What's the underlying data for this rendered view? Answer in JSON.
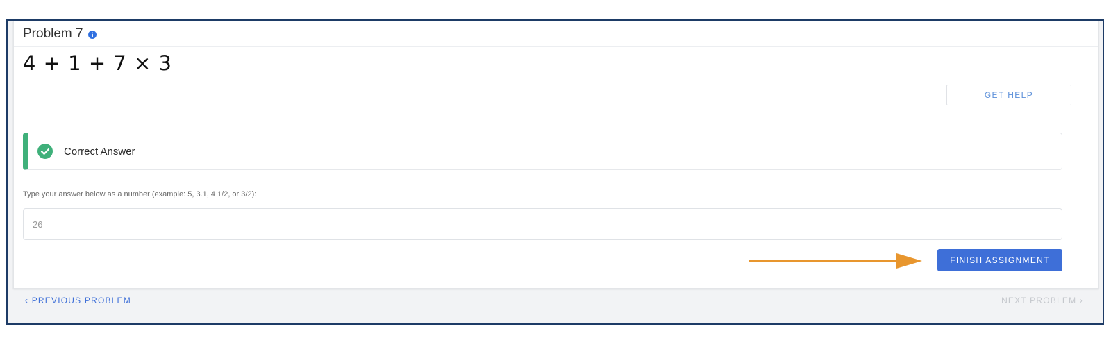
{
  "problem": {
    "title": "Problem 7",
    "info_icon": "info-icon",
    "expression": "4 + 1 + 7 × 3"
  },
  "help": {
    "label": "GET HELP"
  },
  "feedback": {
    "icon": "check-circle-icon",
    "text": "Correct Answer",
    "accent_color": "#3fb07a"
  },
  "answer": {
    "instruction": "Type your answer below as a number (example: 5, 3.1, 4 1/2, or 3/2):",
    "value": "26"
  },
  "finish": {
    "label": "FINISH ASSIGNMENT",
    "color": "#3e6fd8"
  },
  "annotation": {
    "arrow_color": "#e8962e"
  },
  "nav": {
    "previous_label": "‹ PREVIOUS PROBLEM",
    "next_label": "NEXT PROBLEM ›"
  }
}
